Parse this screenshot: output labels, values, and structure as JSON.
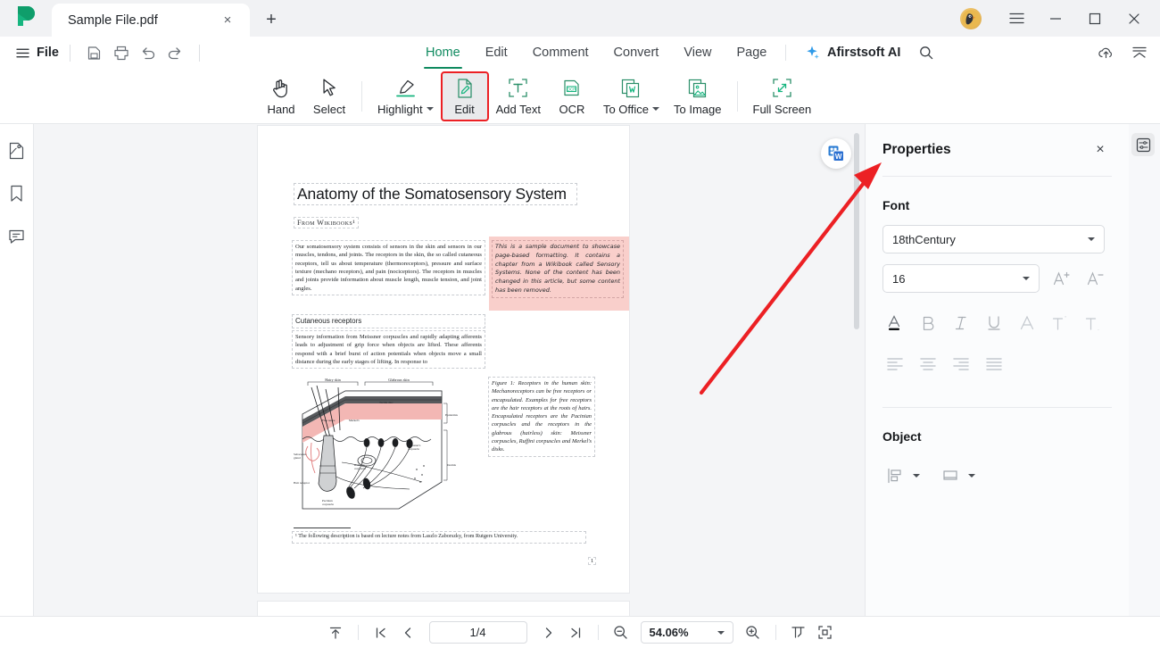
{
  "window": {
    "tab_title": "Sample File.pdf",
    "new_tab_label": "+",
    "close_label": "×",
    "minimize_label": "–",
    "maximize_label": "□",
    "app_close_label": "×"
  },
  "menubar": {
    "file_label": "File",
    "quick_actions": [
      "save-icon",
      "print-icon",
      "undo-icon",
      "redo-icon"
    ]
  },
  "ribbon": {
    "tabs": [
      {
        "label": "Home",
        "active": true
      },
      {
        "label": "Edit",
        "active": false
      },
      {
        "label": "Comment",
        "active": false
      },
      {
        "label": "Convert",
        "active": false
      },
      {
        "label": "View",
        "active": false
      },
      {
        "label": "Page",
        "active": false
      }
    ],
    "ai_label": "Afirstsoft AI"
  },
  "toolbar": {
    "items": [
      {
        "label": "Hand",
        "icon": "hand-icon",
        "caret": false,
        "selected": false
      },
      {
        "label": "Select",
        "icon": "cursor-icon",
        "caret": false,
        "selected": false
      },
      {
        "label": "Highlight",
        "icon": "highlighter-icon",
        "caret": true,
        "selected": false
      },
      {
        "label": "Edit",
        "icon": "edit-page-icon",
        "caret": false,
        "selected": true
      },
      {
        "label": "Add Text",
        "icon": "add-text-icon",
        "caret": false,
        "selected": false
      },
      {
        "label": "OCR",
        "icon": "ocr-icon",
        "caret": false,
        "selected": false
      },
      {
        "label": "To Office",
        "icon": "to-office-icon",
        "caret": true,
        "selected": false
      },
      {
        "label": "To Image",
        "icon": "to-image-icon",
        "caret": false,
        "selected": false
      },
      {
        "label": "Full Screen",
        "icon": "full-screen-icon",
        "caret": false,
        "selected": false
      }
    ],
    "selection_color": "#ec2024"
  },
  "left_rail": {
    "items": [
      "thumbnails-icon",
      "bookmark-icon",
      "comment-icon"
    ]
  },
  "document": {
    "title": "Anatomy of the Somatosensory System",
    "subtitle": "From Wikibooks¹",
    "intro": "Our somatosensory system consists of sensors in the skin and sensors in our muscles, tendons, and joints. The receptors in the skin, the so called cutaneous receptors, tell us about temperature (thermoreceptors), pressure and surface texture (mechano receptors), and pain (nociceptors). The receptors in muscles and joints provide information about muscle length, muscle tension, and joint angles.",
    "sample_note": "This is a sample document to showcase page-based formatting. It contains a chapter from a Wikibook called Sensory Systems. None of the content has been changed in this article, but some content has been removed.",
    "sample_note_bg": "#f9cfcb",
    "section_heading": "Cutaneous receptors",
    "section_body": "Sensory information from Meissner corpuscles and rapidly adapting afferents leads to adjustment of grip force when objects are lifted. These afferents respond with a brief burst of action potentials when objects move a small distance during the early stages of lifting. In response to",
    "figure_caption": "Figure 1: Receptors in the human skin: Mechanoreceptors can be free receptors or encapsulated. Examples for free receptors are the hair receptors at the roots of hairs. Encapsulated receptors are the Pacinian corpuscles and the receptors in the glabrous (hairless) skin: Meissner corpuscles, Ruffini corpuscles and Merkel's disks.",
    "footnote": "¹ The following description is based on lecture notes from Laszlo Zaborszky, from Rutgers University.",
    "page_number": "1",
    "figure_labels": {
      "hairy_skin": "Hairy skin",
      "glabrous_skin": "Glabrous skin",
      "epidermis": "Epidermis",
      "dermis": "Dermis",
      "free_nerve": "Free nerve endings",
      "merkel": "Merkel's disks",
      "tactile": "Tactile disc",
      "meissner": "Meissner's corpuscle",
      "ruffini": "Ruffini's corpuscle",
      "pacinian": "Pacinian corpuscle",
      "hair_receptor": "Hair receptor",
      "sebaceous": "Sebaceous gland"
    }
  },
  "word_badge": {
    "icon": "word-convert-icon"
  },
  "properties": {
    "title": "Properties",
    "close_label": "×",
    "font_section": "Font",
    "font_family": "18thCentury",
    "font_size": "16",
    "grow_font_icon": "increase-font-icon",
    "shrink_font_icon": "decrease-font-icon",
    "style_buttons": [
      {
        "icon": "font-color-icon",
        "label": "A"
      },
      {
        "icon": "bold-icon",
        "label": "B"
      },
      {
        "icon": "italic-icon",
        "label": "I"
      },
      {
        "icon": "underline-icon",
        "label": "U"
      },
      {
        "icon": "text-outline-icon",
        "label": "A"
      },
      {
        "icon": "superscript-icon",
        "label": "T"
      },
      {
        "icon": "subscript-icon",
        "label": "T"
      }
    ],
    "align_buttons": [
      "align-left-icon",
      "align-center-icon",
      "align-right-icon",
      "align-justify-icon"
    ],
    "object_section": "Object",
    "object_buttons": [
      "align-objects-icon",
      "arrange-objects-icon"
    ],
    "accent_underline": "#16181b"
  },
  "panel_toggle": {
    "icon": "properties-panel-icon"
  },
  "statusbar": {
    "fit_top_icon": "scroll-to-top-icon",
    "first_page_icon": "first-page-icon",
    "prev_page_icon": "previous-page-icon",
    "page_indicator": "1/4",
    "next_page_icon": "next-page-icon",
    "last_page_icon": "last-page-icon",
    "zoom_out_icon": "zoom-out-icon",
    "zoom_level": "54.06%",
    "zoom_in_icon": "zoom-in-icon",
    "fit_width_icon": "fit-width-icon",
    "fit_page_icon": "fit-page-icon"
  },
  "annotation": {
    "arrow_color": "#ec2024"
  }
}
